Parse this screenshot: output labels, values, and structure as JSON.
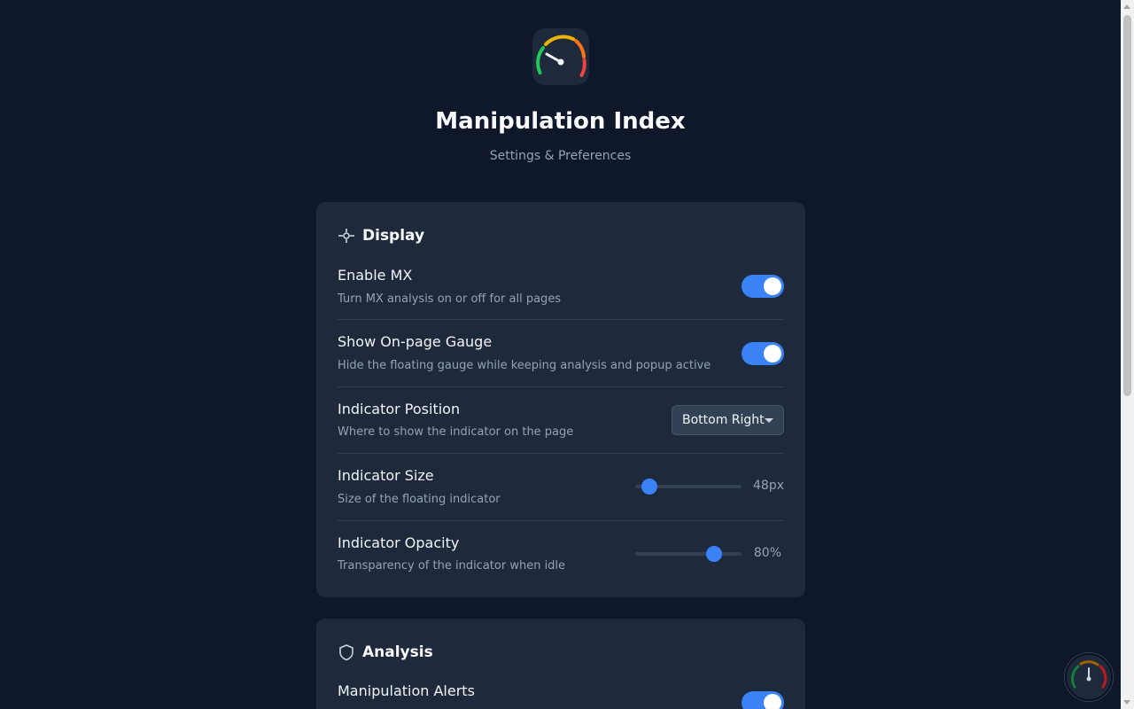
{
  "app": {
    "title": "Manipulation Index",
    "subtitle": "Settings & Preferences",
    "logo_icon": "gauge-icon",
    "accent_color": "#3b82f6"
  },
  "sections": {
    "display": {
      "title": "Display",
      "icon": "crosshair-icon",
      "enable_mx": {
        "title": "Enable MX",
        "description": "Turn MX analysis on or off for all pages",
        "enabled": true
      },
      "show_gauge": {
        "title": "Show On-page Gauge",
        "description": "Hide the floating gauge while keeping analysis and popup active",
        "enabled": true
      },
      "indicator_position": {
        "title": "Indicator Position",
        "description": "Where to show the indicator on the page",
        "selected": "Bottom Right"
      },
      "indicator_size": {
        "title": "Indicator Size",
        "description": "Size of the floating indicator",
        "value_label": "48px",
        "fraction": 0.13
      },
      "indicator_opacity": {
        "title": "Indicator Opacity",
        "description": "Transparency of the indicator when idle",
        "value_label": "80%",
        "fraction": 0.74
      }
    },
    "analysis": {
      "title": "Analysis",
      "icon": "shield-icon",
      "manipulation_alerts": {
        "title": "Manipulation Alerts",
        "enabled": true
      }
    }
  },
  "floating_indicator": {
    "icon": "gauge-icon"
  }
}
